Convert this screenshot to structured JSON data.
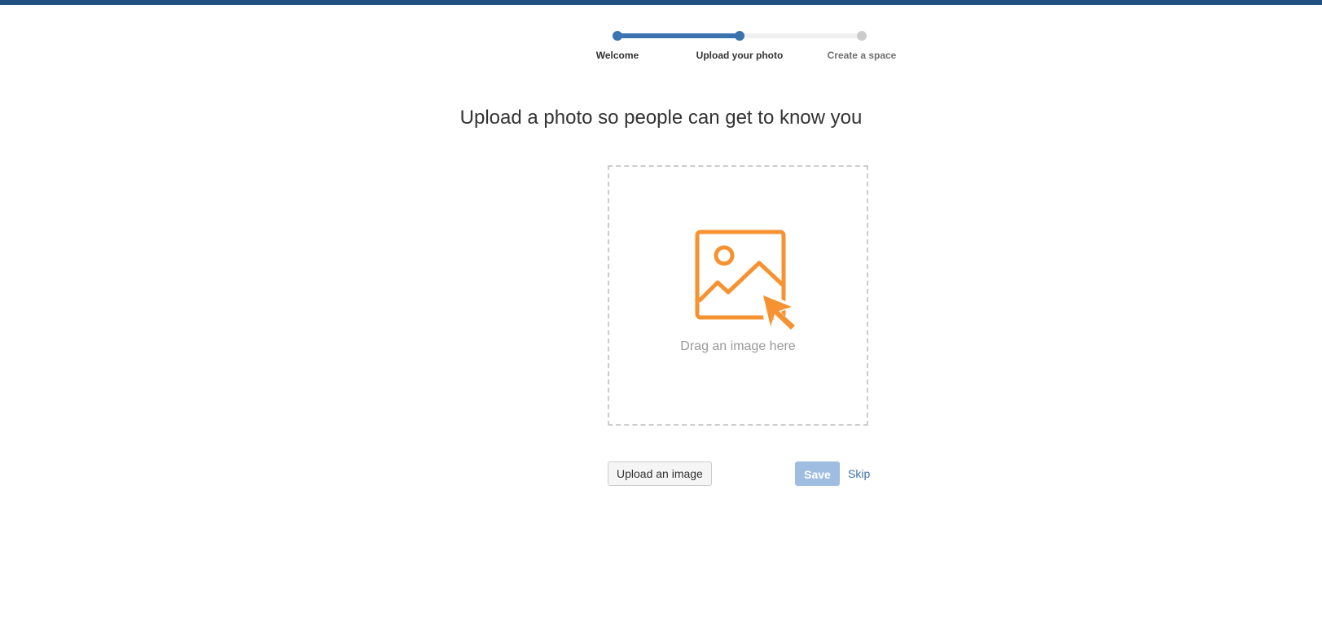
{
  "progress": {
    "steps": [
      {
        "label": "Welcome",
        "state": "complete"
      },
      {
        "label": "Upload your photo",
        "state": "current"
      },
      {
        "label": "Create a space",
        "state": "pending"
      }
    ],
    "current_step": 2,
    "total_steps": 3
  },
  "page": {
    "title": "Upload a photo so people can get to know you"
  },
  "dropzone": {
    "icon": "image-cursor-icon",
    "text": "Drag an image here"
  },
  "actions": {
    "upload_label": "Upload an image",
    "save_label": "Save",
    "skip_label": "Skip"
  },
  "colors": {
    "header_bar": "#205081",
    "progress_active": "#3b73af",
    "progress_inactive": "#cccccc",
    "icon_accent": "#f79232",
    "save_button_disabled": "#9ebde0",
    "link": "#3b73af"
  }
}
